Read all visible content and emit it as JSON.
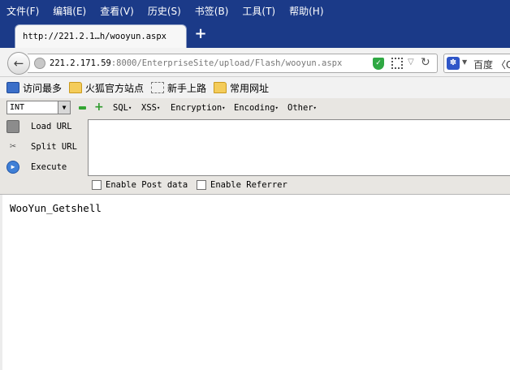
{
  "menu": [
    "文件(F)",
    "编辑(E)",
    "查看(V)",
    "历史(S)",
    "书签(B)",
    "工具(T)",
    "帮助(H)"
  ],
  "tab": {
    "title": "http://221.2.1…h/wooyun.aspx",
    "new_tab_label": "+"
  },
  "nav": {
    "url_host": "221.2.171.59",
    "url_rest": ":8000/EnterpriseSite/upload/Flash/wooyun.aspx",
    "search_placeholder": "百度 〈Ct"
  },
  "bookmarks": [
    {
      "label": "访问最多",
      "icon": "search-icon"
    },
    {
      "label": "火狐官方站点",
      "icon": "folder-icon"
    },
    {
      "label": "新手上路",
      "icon": "dashed-box-icon"
    },
    {
      "label": "常用网址",
      "icon": "folder-icon"
    }
  ],
  "hackbar": {
    "select_value": "INT",
    "menus": [
      "SQL",
      "XSS",
      "Encryption",
      "Encoding",
      "Other"
    ],
    "actions": [
      "Load URL",
      "Split URL",
      "Execute"
    ],
    "textarea_value": "",
    "options": [
      "Enable Post data",
      "Enable Referrer"
    ]
  },
  "page": {
    "body_text": "WooYun_Getshell"
  },
  "colors": {
    "menubar": "#1b3a88",
    "accent_green": "#33a532"
  }
}
